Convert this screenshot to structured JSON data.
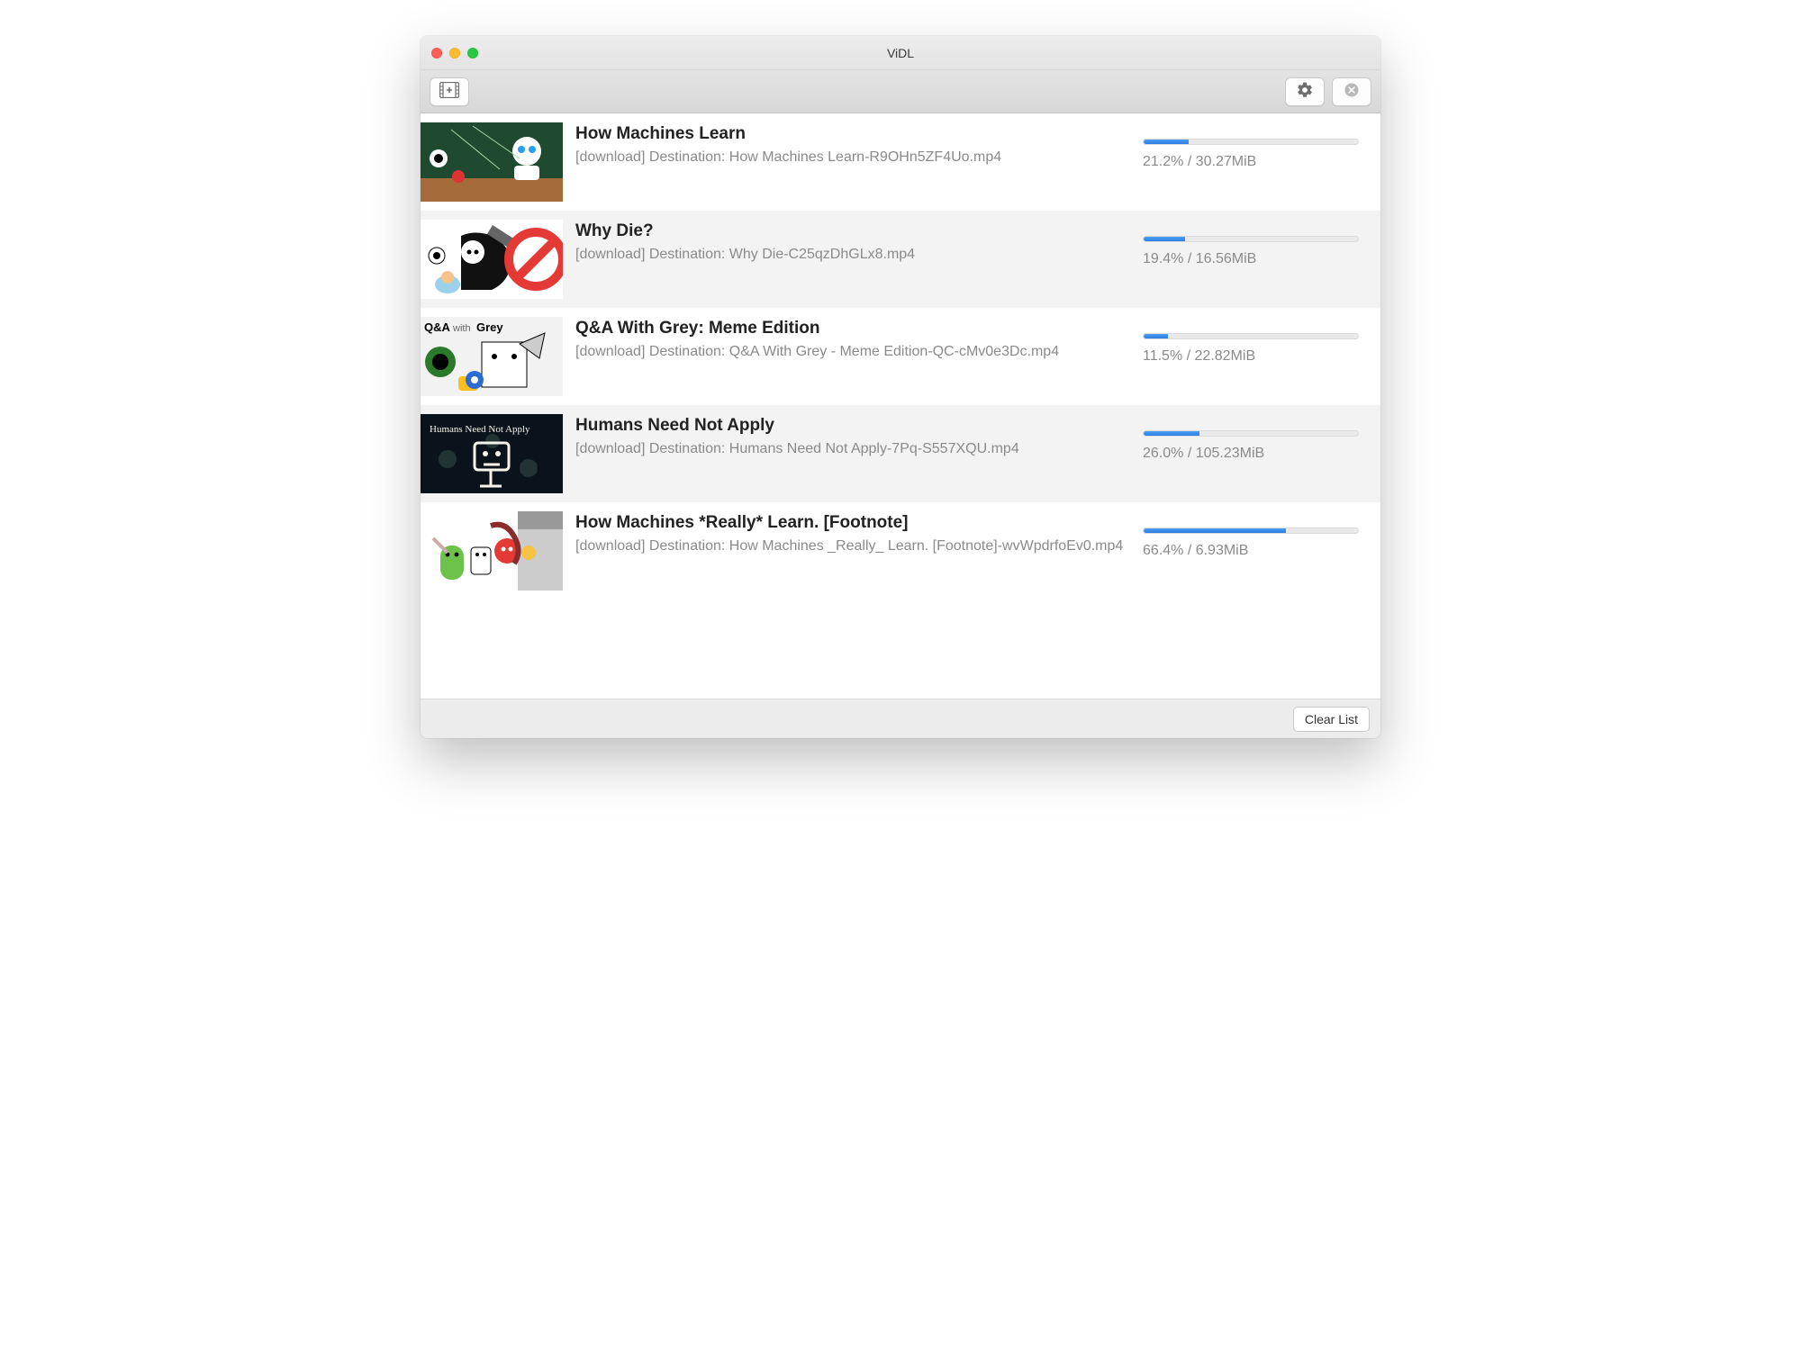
{
  "window": {
    "title": "ViDL"
  },
  "toolbar": {
    "add_label": "Add",
    "settings_label": "Settings",
    "cancel_label": "Cancel"
  },
  "footer": {
    "clear_label": "Clear List"
  },
  "downloads": [
    {
      "title": "How Machines Learn",
      "subtitle": "[download] Destination: How Machines Learn-R9OHn5ZF4Uo.mp4",
      "percent": 21.2,
      "size": "30.27MiB",
      "status_text": "21.2% / 30.27MiB"
    },
    {
      "title": "Why Die?",
      "subtitle": "[download] Destination: Why Die-C25qzDhGLx8.mp4",
      "percent": 19.4,
      "size": "16.56MiB",
      "status_text": "19.4% / 16.56MiB"
    },
    {
      "title": "Q&A With Grey: Meme Edition",
      "subtitle": "[download] Destination: Q&A With Grey - Meme Edition-QC-cMv0e3Dc.mp4",
      "percent": 11.5,
      "size": "22.82MiB",
      "status_text": "11.5% / 22.82MiB"
    },
    {
      "title": "Humans Need Not Apply",
      "subtitle": "[download] Destination: Humans Need Not Apply-7Pq-S557XQU.mp4",
      "percent": 26.0,
      "size": "105.23MiB",
      "status_text": "26.0% / 105.23MiB"
    },
    {
      "title": "How Machines *Really* Learn.  [Footnote]",
      "subtitle": "[download] Destination: How Machines _Really_ Learn.  [Footnote]-wvWpdrfoEv0.mp4",
      "percent": 66.4,
      "size": "6.93MiB",
      "status_text": "66.4% / 6.93MiB"
    }
  ]
}
